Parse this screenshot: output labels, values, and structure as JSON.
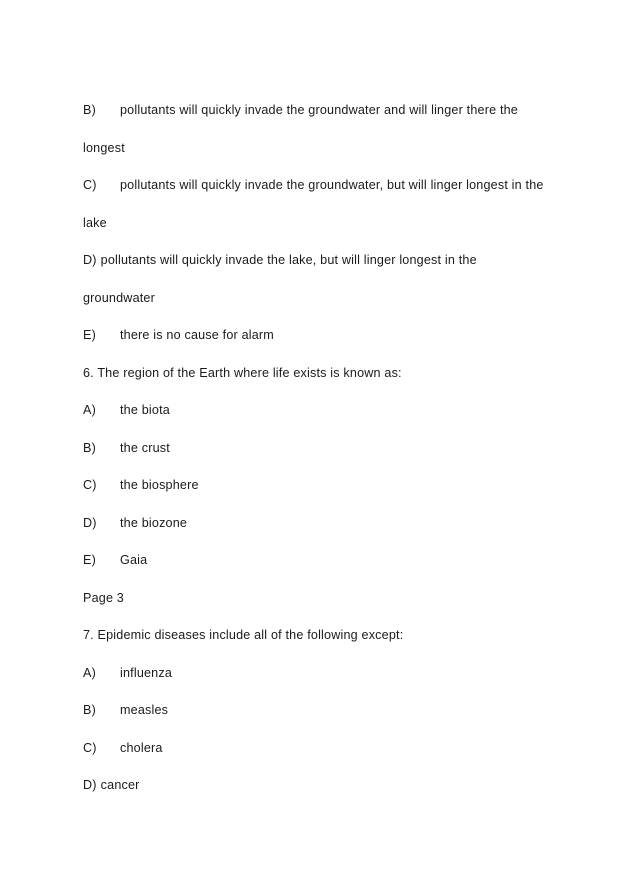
{
  "document": {
    "page_label": "Page 3",
    "background_color": "#ffffff",
    "text_color": "#1b1b1b",
    "lines": [
      {
        "id": "q5-opt-b",
        "kind": "option",
        "label": "B)",
        "text": "pollutants will quickly invade the groundwater and will linger there the"
      },
      {
        "id": "q5-opt-b-cont",
        "kind": "continuation",
        "label": "",
        "text": "longest"
      },
      {
        "id": "q5-opt-c",
        "kind": "option",
        "label": "C)",
        "text": "pollutants will quickly invade the groundwater, but will linger longest in the"
      },
      {
        "id": "q5-opt-c-cont",
        "kind": "continuation",
        "label": "",
        "text": "lake"
      },
      {
        "id": "q5-opt-d",
        "kind": "option-flat",
        "label": "D)",
        "text": "pollutants will quickly invade the lake, but will linger longest in the"
      },
      {
        "id": "q5-opt-d-cont",
        "kind": "continuation",
        "label": "",
        "text": "groundwater"
      },
      {
        "id": "q5-opt-e",
        "kind": "option",
        "label": "E)",
        "text": "there is no cause for alarm"
      },
      {
        "id": "q6-stem",
        "kind": "question",
        "label": "",
        "text": "6. The region of the Earth where life exists is known as:"
      },
      {
        "id": "q6-opt-a",
        "kind": "option",
        "label": "A)",
        "text": "the biota"
      },
      {
        "id": "q6-opt-b",
        "kind": "option",
        "label": "B)",
        "text": "the crust"
      },
      {
        "id": "q6-opt-c",
        "kind": "option",
        "label": "C)",
        "text": "the biosphere"
      },
      {
        "id": "q6-opt-d",
        "kind": "option",
        "label": "D)",
        "text": "the biozone"
      },
      {
        "id": "q6-opt-e",
        "kind": "option",
        "label": "E)",
        "text": "Gaia"
      },
      {
        "id": "page-marker",
        "kind": "page-marker",
        "label": "",
        "text": "Page 3"
      },
      {
        "id": "q7-stem",
        "kind": "question",
        "label": "",
        "text": "7. Epidemic diseases include all of the following except:"
      },
      {
        "id": "q7-opt-a",
        "kind": "option",
        "label": "A)",
        "text": "influenza"
      },
      {
        "id": "q7-opt-b",
        "kind": "option",
        "label": "B)",
        "text": "measles"
      },
      {
        "id": "q7-opt-c",
        "kind": "option",
        "label": "C)",
        "text": "cholera"
      },
      {
        "id": "q7-opt-d",
        "kind": "option-flat",
        "label": "D)",
        "text": "cancer"
      }
    ]
  }
}
